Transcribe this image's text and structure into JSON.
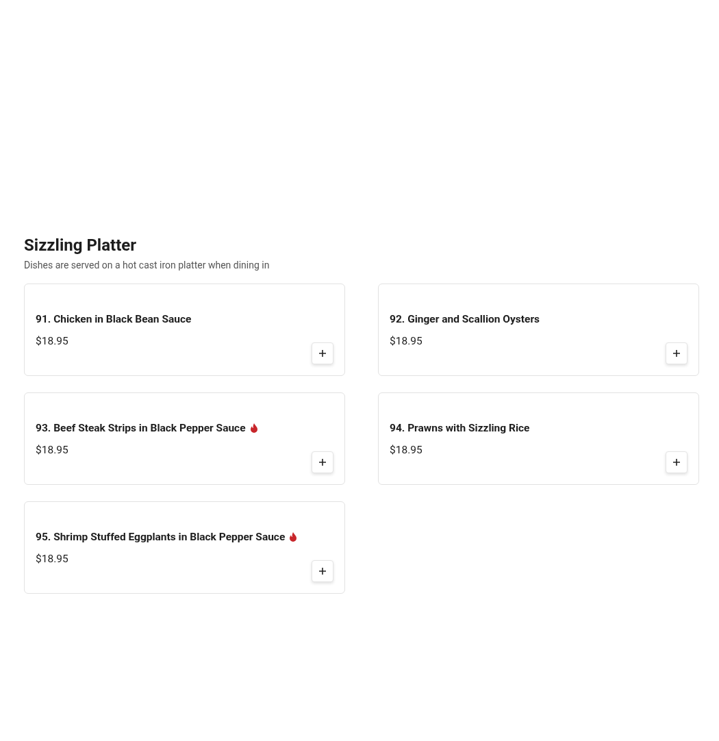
{
  "section": {
    "title": "Sizzling Platter",
    "description": "Dishes are served on a hot cast iron platter when dining in"
  },
  "items": [
    {
      "name": "91. Chicken in Black Bean Sauce",
      "price": "$18.95",
      "spicy": false
    },
    {
      "name": "92. Ginger and Scallion Oysters",
      "price": "$18.95",
      "spicy": false
    },
    {
      "name": "93. Beef Steak Strips in Black Pepper Sauce",
      "price": "$18.95",
      "spicy": true
    },
    {
      "name": "94. Prawns with Sizzling Rice",
      "price": "$18.95",
      "spicy": false
    },
    {
      "name": "95. Shrimp Stuffed Eggplants in Black Pepper Sauce",
      "price": "$18.95",
      "spicy": true
    }
  ]
}
